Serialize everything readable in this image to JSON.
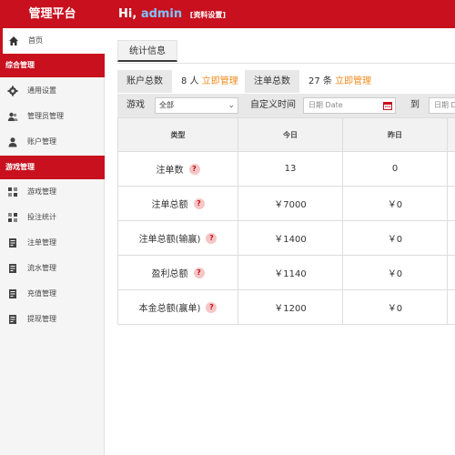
{
  "topbar": {
    "brand": "管理平台",
    "greeting": "Hi,",
    "username": "admin",
    "settings_link": "[资料设置]"
  },
  "sidebar": {
    "home": {
      "label": "首页",
      "icon": "home-icon"
    },
    "group1": "综合管理",
    "group1_items": [
      {
        "label": "通用设置",
        "icon": "gear-icon"
      },
      {
        "label": "管理员管理",
        "icon": "users-icon"
      },
      {
        "label": "账户管理",
        "icon": "user-icon"
      }
    ],
    "group2": "游戏管理",
    "group2_items": [
      {
        "label": "游戏管理",
        "icon": "grid-icon"
      },
      {
        "label": "投注统计",
        "icon": "grid-icon"
      },
      {
        "label": "注单管理",
        "icon": "document-icon"
      },
      {
        "label": "流水管理",
        "icon": "document-icon"
      },
      {
        "label": "充值管理",
        "icon": "document-icon"
      },
      {
        "label": "提现管理",
        "icon": "document-icon"
      }
    ]
  },
  "tabs": {
    "active": "统计信息"
  },
  "stats": {
    "accounts_label": "账户总数",
    "accounts_value": "8 人",
    "accounts_link": "立即管理",
    "orders_label": "注单总数",
    "orders_value": "27 条",
    "orders_link": "立即管理"
  },
  "filters": {
    "game_label": "游戏",
    "game_selected": "全部",
    "time_label": "自定义时间",
    "date_placeholder": "日期 Date",
    "to_label": "到",
    "date2_placeholder": "日期 Date"
  },
  "table": {
    "headers": [
      "类型",
      "今日",
      "昨日"
    ],
    "rows": [
      {
        "type": "注单数",
        "today": "13",
        "yesterday": "0"
      },
      {
        "type": "注单总额",
        "today": "￥7000",
        "yesterday": "￥0"
      },
      {
        "type": "注单总额(输赢)",
        "today": "￥1400",
        "yesterday": "￥0"
      },
      {
        "type": "盈利总额",
        "today": "￥1140",
        "yesterday": "￥0"
      },
      {
        "type": "本金总额(赢单)",
        "today": "￥1200",
        "yesterday": "￥0"
      }
    ],
    "help_glyph": "?"
  },
  "colors": {
    "brand_red": "#c8101e",
    "link_orange": "#f08a1c",
    "username_blue": "#7cc4ff"
  }
}
